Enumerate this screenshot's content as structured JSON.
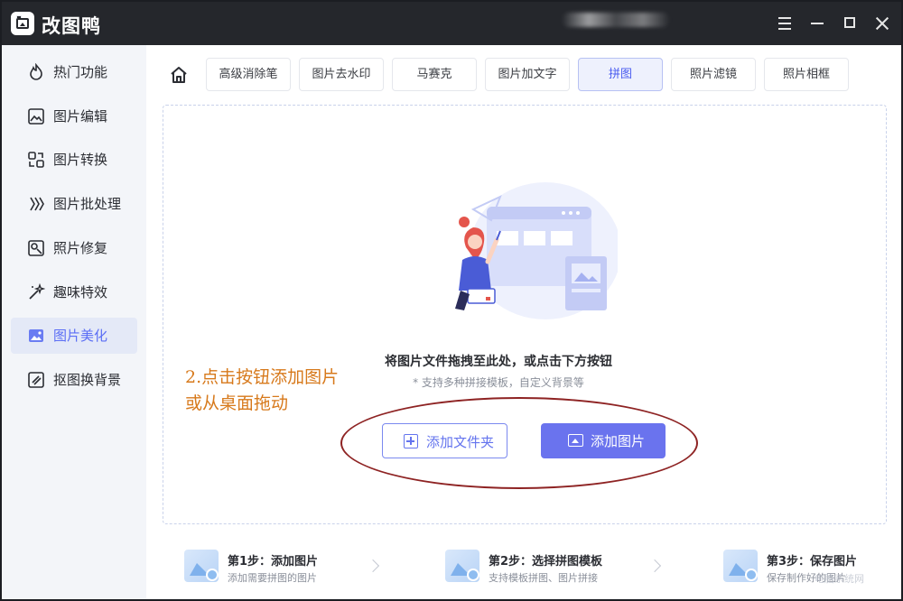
{
  "app": {
    "title": "改图鸭"
  },
  "window_controls": [
    "menu-icon",
    "minimize-icon",
    "maximize-icon",
    "close-icon"
  ],
  "sidebar": {
    "items": [
      {
        "label": "热门功能",
        "icon": "fire-icon"
      },
      {
        "label": "图片编辑",
        "icon": "image-edit-icon"
      },
      {
        "label": "图片转换",
        "icon": "convert-icon"
      },
      {
        "label": "图片批处理",
        "icon": "batch-icon"
      },
      {
        "label": "照片修复",
        "icon": "photo-repair-icon"
      },
      {
        "label": "趣味特效",
        "icon": "magic-wand-icon"
      },
      {
        "label": "图片美化",
        "icon": "beautify-icon",
        "active": true
      },
      {
        "label": "抠图换背景",
        "icon": "cutout-icon"
      }
    ]
  },
  "tabs": {
    "items": [
      {
        "label": "高级消除笔"
      },
      {
        "label": "图片去水印"
      },
      {
        "label": "马赛克"
      },
      {
        "label": "图片加文字"
      },
      {
        "label": "拼图",
        "active": true
      },
      {
        "label": "照片滤镜"
      },
      {
        "label": "照片相框"
      }
    ]
  },
  "dropzone": {
    "main_text": "将图片文件拖拽至此处，或点击下方按钮",
    "sub_text": "* 支持多种拼接模板，自定义背景等",
    "folder_button": "添加文件夹",
    "add_button": "添加图片"
  },
  "annotation": {
    "line1": "2.点击按钮添加图片",
    "line2": "或从桌面拖动"
  },
  "steps": [
    {
      "title": "第1步：添加图片",
      "desc": "添加需要拼图的图片"
    },
    {
      "title": "第2步：选择拼图模板",
      "desc": "支持模板拼图、图片拼接"
    },
    {
      "title": "第3步：保存图片",
      "desc": "保存制作好的图片"
    }
  ],
  "watermark": "电脑系统网",
  "colors": {
    "accent": "#6a73ee",
    "titlebar": "#25272c",
    "sidebar_bg": "#f3f5f9",
    "annotation": "#d7791b",
    "ellipse": "#8e2323"
  }
}
